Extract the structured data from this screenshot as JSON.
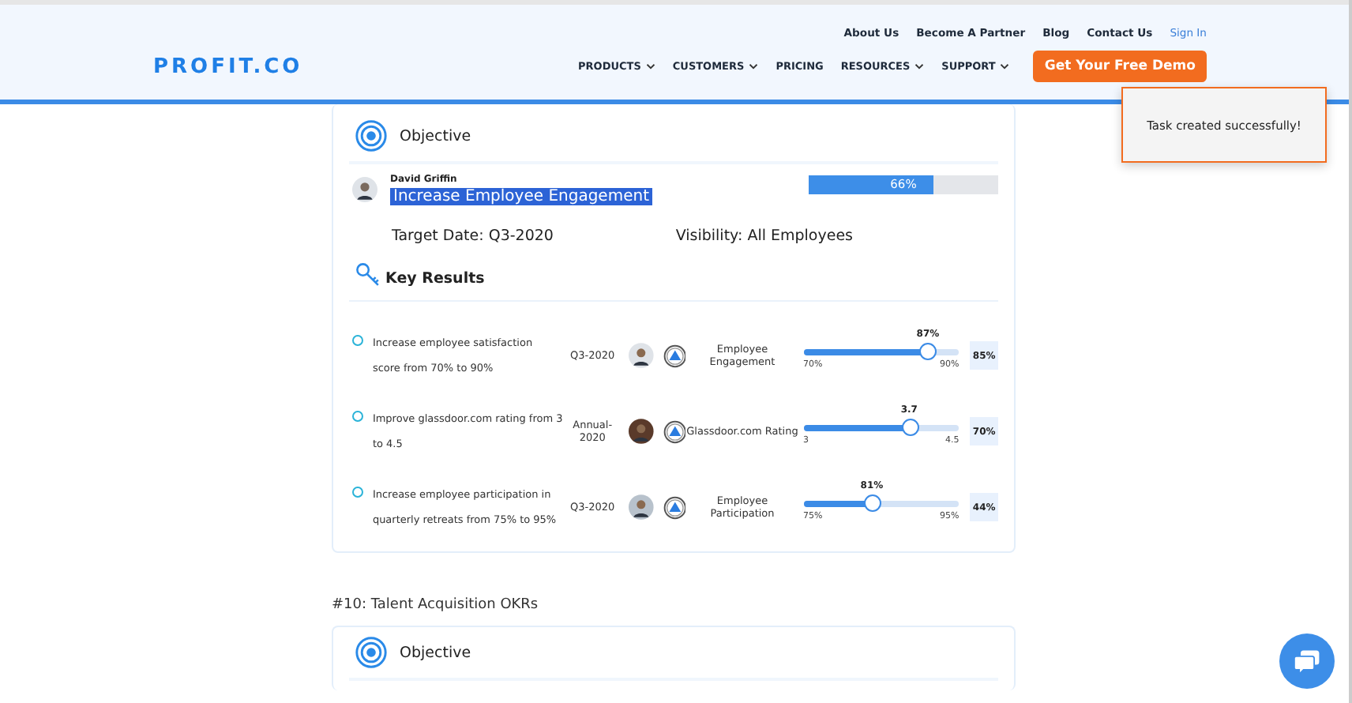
{
  "header": {
    "logo": "PROFIT.CO",
    "top_links": [
      {
        "label": "About Us",
        "kind": "plain"
      },
      {
        "label": "Become A Partner",
        "kind": "plain"
      },
      {
        "label": "Blog",
        "kind": "plain"
      },
      {
        "label": "Contact Us",
        "kind": "plain"
      },
      {
        "label": "Sign In",
        "kind": "accent"
      }
    ],
    "nav": [
      {
        "label": "PRODUCTS",
        "dropdown": true
      },
      {
        "label": "CUSTOMERS",
        "dropdown": true
      },
      {
        "label": "PRICING",
        "dropdown": false
      },
      {
        "label": "RESOURCES",
        "dropdown": true
      },
      {
        "label": "SUPPORT",
        "dropdown": true
      }
    ],
    "cta": "Get Your Free Demo"
  },
  "toast": "Task created successfully!",
  "objective_card": {
    "heading": "Objective",
    "owner": "David Griffin",
    "title": "Increase Employee Engagement",
    "title_selected": true,
    "progress": {
      "level": 0.66,
      "label": "66%"
    },
    "target_date": "Target Date: Q3-2020",
    "visibility": "Visibility: All Employees",
    "key_results_heading": "Key Results",
    "key_results": [
      {
        "checked": false,
        "text": "Increase employee satisfaction score from 70% to 90%",
        "period": "Q3-2020",
        "metric": "Employee Engagement",
        "value": "87%",
        "min": "70%",
        "max": "90%",
        "level": 0.8,
        "score": "85%"
      },
      {
        "checked": false,
        "text": "Improve glassdoor.com rating from 3 to 4.5",
        "period": "Annual-2020",
        "metric": "Glassdoor.com Rating",
        "value": "3.7",
        "min": "3",
        "max": "4.5",
        "level": 0.68,
        "score": "70%"
      },
      {
        "checked": false,
        "text": "Increase employee participation in quarterly retreats from 75% to 95%",
        "period": "Q3-2020",
        "metric": "Employee Participation",
        "value": "81%",
        "min": "75%",
        "max": "95%",
        "level": 0.44,
        "score": "44%"
      }
    ]
  },
  "next_section": {
    "heading": "#10: Talent Acquisition OKRs",
    "card_heading": "Objective"
  }
}
